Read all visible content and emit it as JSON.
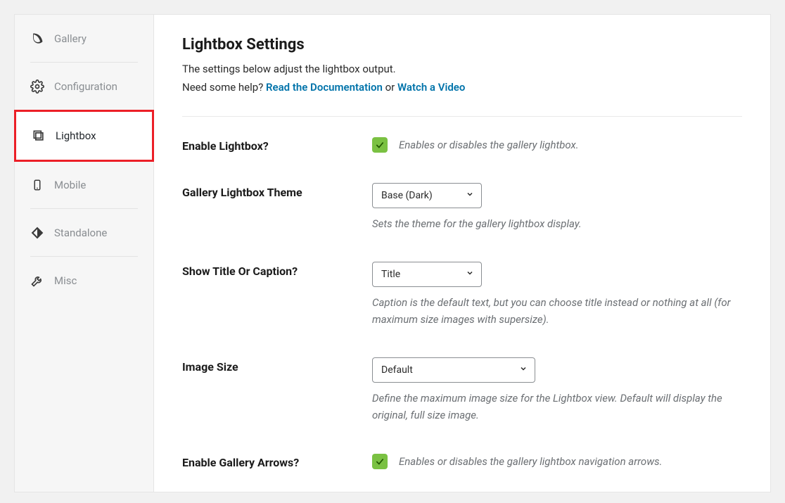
{
  "sidebar": {
    "items": [
      {
        "label": "Gallery"
      },
      {
        "label": "Configuration"
      },
      {
        "label": "Lightbox"
      },
      {
        "label": "Mobile"
      },
      {
        "label": "Standalone"
      },
      {
        "label": "Misc"
      }
    ]
  },
  "header": {
    "title": "Lightbox Settings",
    "intro_line1": "The settings below adjust the lightbox output.",
    "intro_prefix": "Need some help? ",
    "link_docs": "Read the Documentation",
    "or_text": " or ",
    "link_video": "Watch a Video"
  },
  "settings": {
    "enable_lightbox": {
      "label": "Enable Lightbox?",
      "hint": "Enables or disables the gallery lightbox."
    },
    "theme": {
      "label": "Gallery Lightbox Theme",
      "value": "Base (Dark)",
      "hint": "Sets the theme for the gallery lightbox display."
    },
    "title_caption": {
      "label": "Show Title Or Caption?",
      "value": "Title",
      "hint": "Caption is the default text, but you can choose title instead or nothing at all (for maximum size images with supersize)."
    },
    "image_size": {
      "label": "Image Size",
      "value": "Default",
      "hint": "Define the maximum image size for the Lightbox view. Default will display the original, full size image."
    },
    "arrows": {
      "label": "Enable Gallery Arrows?",
      "hint": "Enables or disables the gallery lightbox navigation arrows."
    }
  }
}
